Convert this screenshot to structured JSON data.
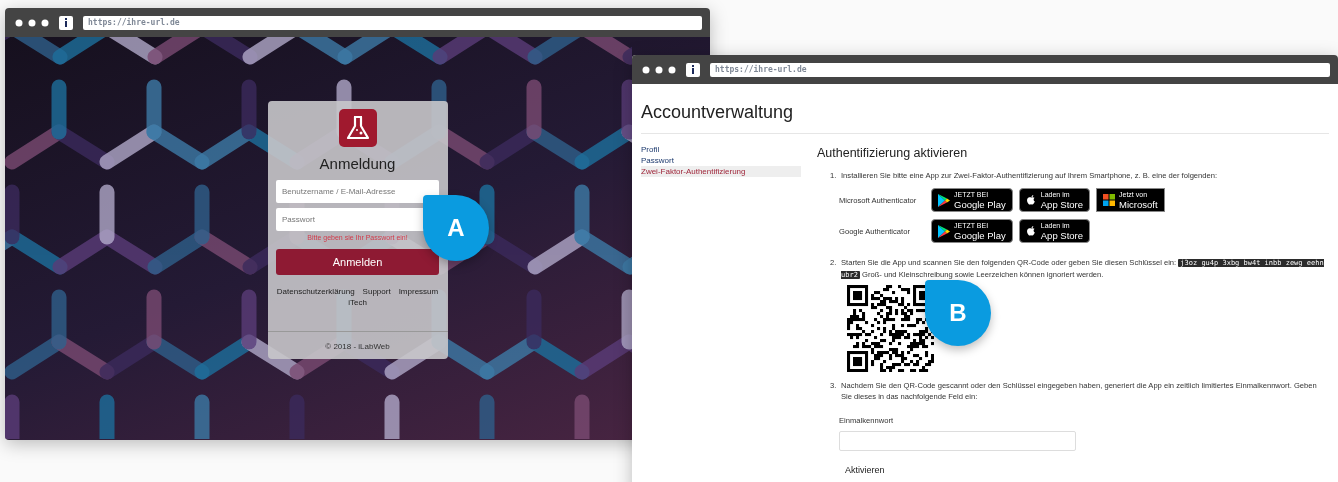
{
  "login_window": {
    "url": "https://ihre-url.de",
    "title": "Anmeldung",
    "fields": [
      {
        "placeholder": "Benutzername / E-Mail-Adresse"
      },
      {
        "placeholder": "Passwort"
      }
    ],
    "error": "Bitte geben sie Ihr Passwort ein!",
    "button": "Anmelden",
    "links": [
      "Datenschutzerklärung",
      "Support",
      "Impressum",
      "iTech"
    ],
    "footer": "© 2018 - iLabWeb"
  },
  "account_window": {
    "url": "https://ihre-url.de",
    "title": "Accountverwaltung",
    "sidebar": {
      "items": [
        {
          "label": "Profil",
          "selected": false
        },
        {
          "label": "Passwort",
          "selected": false
        },
        {
          "label": "Zwei-Faktor-Authentifizierung",
          "selected": true
        }
      ]
    },
    "heading": "Authentifizierung aktivieren",
    "step_1": {
      "number": "1.",
      "text": "Installieren Sie bitte eine App zur Zwei-Faktor-Authentifizierung auf Ihrem Smartphone, z. B. eine der folgenden:",
      "apps": [
        {
          "name": "Microsoft Authenticator",
          "badges": [
            {
              "kind": "google_play",
              "small": "JETZT BEI",
              "big": "Google Play"
            },
            {
              "kind": "app_store",
              "small": "Laden im",
              "big": "App Store"
            },
            {
              "kind": "microsoft",
              "small": "Jetzt von",
              "big": "Microsoft"
            }
          ]
        },
        {
          "name": "Google Authenticator",
          "badges": [
            {
              "kind": "google_play",
              "small": "JETZT BEI",
              "big": "Google Play"
            },
            {
              "kind": "app_store",
              "small": "Laden im",
              "big": "App Store"
            }
          ]
        }
      ]
    },
    "step_2": {
      "number": "2.",
      "text_before": "Starten Sie die App und scannen Sie den folgenden QR-Code oder geben Sie diesen Schlüssel ein:",
      "key": "j3oz gu4p 3xbg bw4t inbb zewg eehn ubr2",
      "text_after": "Groß- und Kleinschreibung sowie Leerzeichen können ignoriert werden."
    },
    "step_3": {
      "number": "3.",
      "text": "Nachdem Sie den QR-Code gescannt oder den Schlüssel eingegeben haben, generiert die App ein zeitlich limitiertes Einmalkennwort. Geben Sie dieses in das nachfolgende Feld ein:",
      "field_label": "Einmalkennwort",
      "button": "Aktivieren"
    }
  },
  "markers": [
    {
      "label": "A"
    },
    {
      "label": "B"
    }
  ]
}
